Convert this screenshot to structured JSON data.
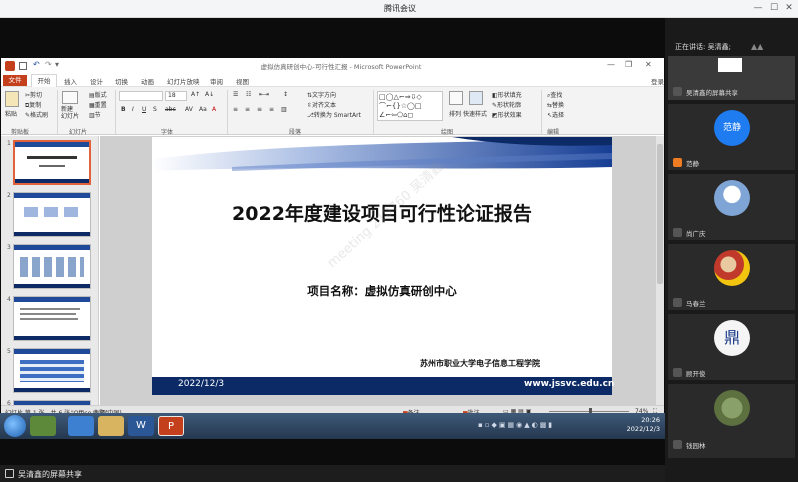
{
  "meeting": {
    "title": "腾讯会议",
    "share_label": "吴清鑫的屏幕共享",
    "speaking_label": "正在讲话: 吴清鑫;"
  },
  "participants": [
    {
      "name": "吴清鑫的屏幕共享",
      "avatar_text": ""
    },
    {
      "name": "范静",
      "avatar_text": "范静"
    },
    {
      "name": "尚广庆",
      "avatar_text": ""
    },
    {
      "name": "马春兰",
      "avatar_text": ""
    },
    {
      "name": "顾开俊",
      "avatar_text": "鼎"
    },
    {
      "name": "钱园林",
      "avatar_text": ""
    }
  ],
  "ppt": {
    "window_title": "虚拟仿真研创中心-可行性汇报 - Microsoft PowerPoint",
    "menus": [
      "文件",
      "开始",
      "插入",
      "设计",
      "切换",
      "动画",
      "幻灯片放映",
      "审阅",
      "视图"
    ],
    "login": "登录",
    "ribbon": {
      "cut": "剪切",
      "copy": "复制",
      "format_painter": "格式刷",
      "paste": "粘贴",
      "new_slide": "新建\n幻灯片",
      "layout": "版式",
      "reset": "重置",
      "section": "节",
      "font_size": "18",
      "text_direction": "文字方向",
      "align_text": "对齐文本",
      "smartart": "转换为 SmartArt",
      "arrange": "排列",
      "quick_styles": "快速样式",
      "shape_fill": "形状填充",
      "shape_outline": "形状轮廓",
      "shape_effects": "形状效果",
      "find": "查找",
      "replace": "替换",
      "select": "选择",
      "groups": [
        "剪贴板",
        "幻灯片",
        "字体",
        "段落",
        "绘图",
        "编辑"
      ]
    },
    "thumb_numbers": [
      "1",
      "2",
      "3",
      "4",
      "5",
      "6"
    ],
    "slide": {
      "title": "2022年度建设项目可行性论证报告",
      "project": "项目名称：虚拟仿真研创中心",
      "school": "苏州市职业大学电子信息工程学院",
      "date": "2022/12/3",
      "url": "www.jssvc.edu.cn",
      "watermark": "meeting 210760 吴清鑫"
    },
    "status": {
      "slide_info": "幻灯片 第 1 张，共 6 张",
      "theme": "\"Office 主题\"",
      "language": "中文(中国)",
      "notes": "备注",
      "comments": "批注",
      "zoom": "74%"
    }
  },
  "taskbar": {
    "time": "20:26",
    "date": "2022/12/3"
  }
}
